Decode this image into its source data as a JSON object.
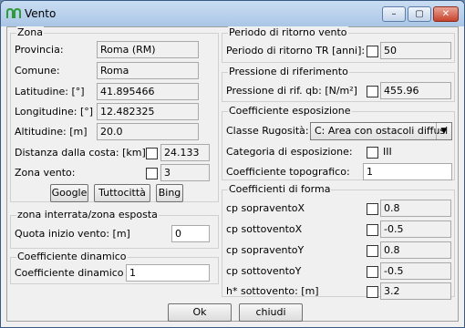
{
  "window": {
    "title": "Vento",
    "minimize": "–",
    "maximize": "▢",
    "close": "✕"
  },
  "zona": {
    "title": "Zona",
    "provincia_label": "Provincia:",
    "provincia_value": "Roma (RM)",
    "comune_label": "Comune:",
    "comune_value": "Roma",
    "latitudine_label": "Latitudine: [°]",
    "latitudine_value": "41.895466",
    "longitudine_label": "Longitudine: [°]",
    "longitudine_value": "12.482325",
    "altitudine_label": "Altitudine: [m]",
    "altitudine_value": "20.0",
    "distanza_label": "Distanza dalla costa: [km]",
    "distanza_value": "24.133",
    "zona_vento_label": "Zona vento:",
    "zona_vento_value": "3",
    "google_label": "Google",
    "tuttocitta_label": "Tuttocittà",
    "bing_label": "Bing"
  },
  "interrata": {
    "title": "zona interrata/zona esposta",
    "quota_label": "Quota inizio vento: [m]",
    "quota_value": "0"
  },
  "dinamico": {
    "title": "Coefficiente dinamico",
    "cd_label": "Coefficiente dinamico cd:",
    "cd_value": "1"
  },
  "periodo": {
    "title": "Periodo di ritorno vento",
    "tr_label": "Periodo di ritorno TR [anni]:",
    "tr_value": "50"
  },
  "pressione": {
    "title": "Pressione di riferimento",
    "qb_label": "Pressione di rif. qb: [N/m²]",
    "qb_value": "455.96"
  },
  "esposizione": {
    "title": "Coefficiente esposizione",
    "rugosita_label": "Classe Rugosità:",
    "rugosita_value": "C: Area con ostacoli diffusi",
    "categoria_label": "Categoria di esposizione:",
    "categoria_value": "III",
    "topografico_label": "Coefficiente topografico:",
    "topografico_value": "1"
  },
  "forma": {
    "title": "Coefficienti di forma",
    "rows": [
      {
        "label": "cp sopraventoX",
        "value": "0.8"
      },
      {
        "label": "cp sottoventoX",
        "value": "-0.5"
      },
      {
        "label": "cp sopraventoY",
        "value": "0.8"
      },
      {
        "label": "cp sottoventoY",
        "value": "-0.5"
      },
      {
        "label": "h* sottovento: [m]",
        "value": "3.2"
      }
    ]
  },
  "footer": {
    "ok_label": "Ok",
    "chiudi_label": "chiudi"
  }
}
